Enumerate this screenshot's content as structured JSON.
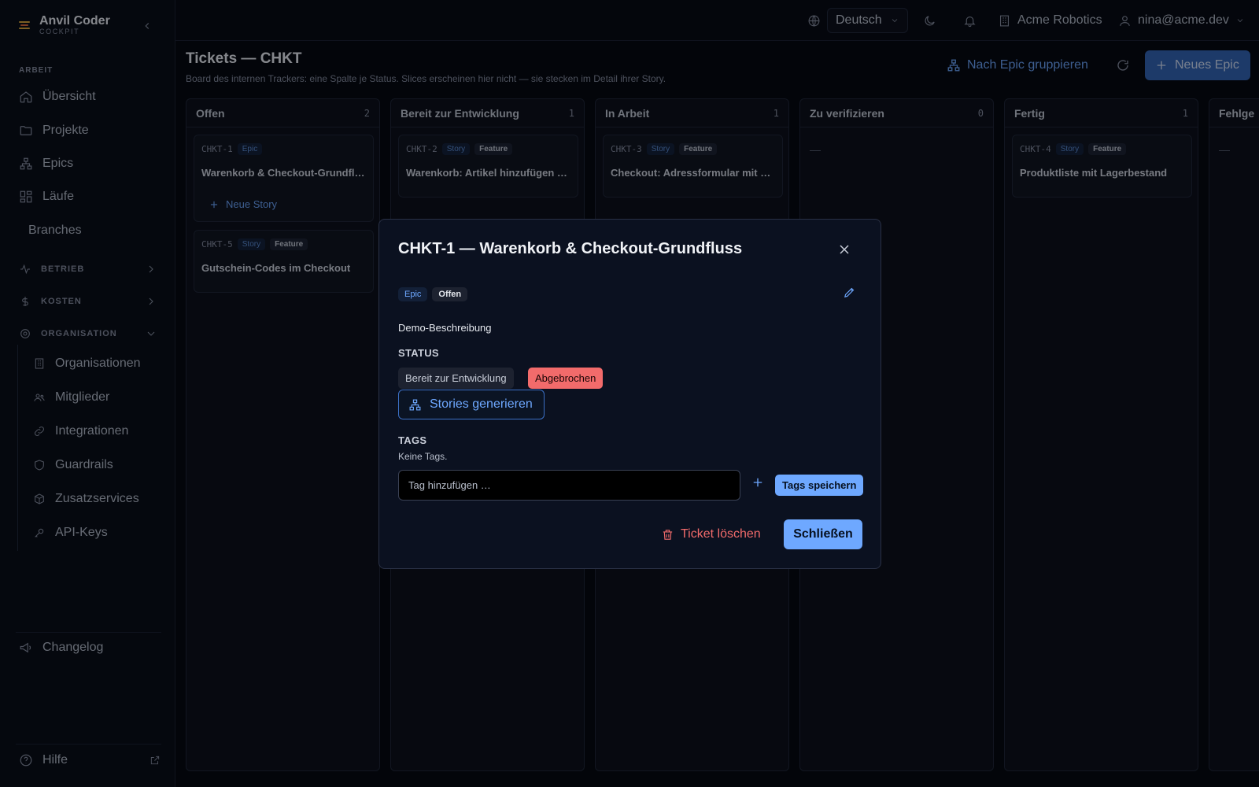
{
  "brand": {
    "name": "Anvil Coder",
    "sub": "COCKPIT"
  },
  "sidebar": {
    "section_work": "ARBEIT",
    "items": [
      {
        "label": "Übersicht",
        "icon": "home-icon"
      },
      {
        "label": "Projekte",
        "icon": "folder-icon"
      },
      {
        "label": "Epics",
        "icon": "hierarchy-icon"
      },
      {
        "label": "Läufe",
        "icon": "grid-icon"
      },
      {
        "label": "Branches",
        "icon": ""
      }
    ],
    "groups": [
      {
        "label": "BETRIEB",
        "icon": "pulse-icon"
      },
      {
        "label": "KOSTEN",
        "icon": "dollar-icon"
      },
      {
        "label": "ORGANISATION",
        "icon": "gear-icon"
      }
    ],
    "org_items": [
      {
        "label": "Organisationen",
        "icon": "building-icon"
      },
      {
        "label": "Mitglieder",
        "icon": "users-icon"
      },
      {
        "label": "Integrationen",
        "icon": "link-icon"
      },
      {
        "label": "Guardrails",
        "icon": "shield-icon"
      },
      {
        "label": "Zusatzservices",
        "icon": "box-icon"
      },
      {
        "label": "API-Keys",
        "icon": "key-icon"
      }
    ],
    "changelog": "Changelog",
    "help": "Hilfe"
  },
  "topbar": {
    "language": "Deutsch",
    "org": "Acme Robotics",
    "user": "nina@acme.dev"
  },
  "header": {
    "title": "Tickets — CHKT",
    "subtitle": "Board des internen Trackers: eine Spalte je Status. Slices erscheinen hier nicht — sie stecken im Detail ihrer Story.",
    "group_btn": "Nach Epic gruppieren",
    "new_epic_btn": "Neues Epic"
  },
  "columns": [
    {
      "title": "Offen",
      "count": "2"
    },
    {
      "title": "Bereit zur Entwicklung",
      "count": "1"
    },
    {
      "title": "In Arbeit",
      "count": "1"
    },
    {
      "title": "Zu verifizieren",
      "count": "0",
      "empty": "—"
    },
    {
      "title": "Fertig",
      "count": "1"
    },
    {
      "title": "Fehlge",
      "count": "",
      "empty": "—"
    }
  ],
  "cards": {
    "c1": {
      "id": "CHKT-1",
      "type": "Epic",
      "title": "Warenkorb & Checkout-Grundfluss",
      "add_story": "Neue Story"
    },
    "c5": {
      "id": "CHKT-5",
      "type": "Story",
      "kind": "Feature",
      "title": "Gutschein-Codes im Checkout"
    },
    "c2": {
      "id": "CHKT-2",
      "type": "Story",
      "kind": "Feature",
      "title": "Warenkorb: Artikel hinzufügen und entfernen"
    },
    "c3": {
      "id": "CHKT-3",
      "type": "Story",
      "kind": "Feature",
      "title": "Checkout: Adressformular mit Validierung"
    },
    "c4": {
      "id": "CHKT-4",
      "type": "Story",
      "kind": "Feature",
      "title": "Produktliste mit Lagerbestand"
    }
  },
  "modal": {
    "title": "CHKT-1 — Warenkorb & Checkout-Grundfluss",
    "badge_type": "Epic",
    "badge_status": "Offen",
    "description": "Demo-Beschreibung",
    "status_label": "STATUS",
    "status_options": [
      "Bereit zur Entwicklung",
      "Abgebrochen"
    ],
    "generate_btn": "Stories generieren",
    "tags_label": "TAGS",
    "no_tags": "Keine Tags.",
    "tag_placeholder": "Tag hinzufügen …",
    "save_tags": "Tags speichern",
    "delete_btn": "Ticket löschen",
    "close_btn": "Schließen"
  },
  "colors": {
    "accent": "#6ea8ff",
    "danger": "#f26b6b",
    "background": "#05070c"
  }
}
